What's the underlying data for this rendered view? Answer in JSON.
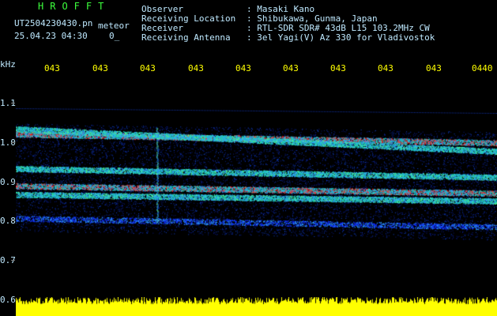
{
  "header": {
    "brand": "HROFFT",
    "filename": "UT2504230430.pn",
    "filename_tag": "meteor",
    "datetime": "25.04.23 04:30",
    "count": "0_"
  },
  "info": [
    {
      "label": "Observer",
      "value": ": Masaki Kano"
    },
    {
      "label": "Receiving Location",
      "value": ": Shibukawa, Gunma, Japan"
    },
    {
      "label": "Receiver",
      "value": ": RTL-SDR SDR# 43dB L15 103.2MHz CW"
    },
    {
      "label": "Receiving Antenna",
      "value": ": 3el Yagi(V) Az 330 for Vladivostok"
    }
  ],
  "colors": {
    "background": "#000000",
    "header_text": "#bfe9ff",
    "brand": "#3cff3c",
    "axis_time": "#ffff00",
    "noise_strip": "#ffff00",
    "signal_low": "#1030ff",
    "signal_mid": "#20d0c0",
    "signal_high": "#ff3030"
  },
  "axis": {
    "unit": "kHz",
    "y_ticks": [
      "1.1",
      "1.0",
      "0.9",
      "0.8",
      "0.7",
      "0.6"
    ],
    "x_ticks": [
      "043",
      "043",
      "043",
      "043",
      "043",
      "043",
      "043",
      "043",
      "043",
      "0440"
    ]
  },
  "spectrogram": {
    "y_range_khz": [
      0.6,
      1.12
    ],
    "bands_khz": [
      {
        "start": 0.985,
        "end": 0.965,
        "level": "high"
      },
      {
        "start": 0.997,
        "end": 0.945,
        "level": "mid"
      },
      {
        "start": 0.905,
        "end": 0.885,
        "level": "mid"
      },
      {
        "start": 0.865,
        "end": 0.848,
        "level": "high"
      },
      {
        "start": 0.845,
        "end": 0.83,
        "level": "mid"
      },
      {
        "start": 0.79,
        "end": 0.77,
        "level": "low"
      }
    ],
    "meteor_time_fraction": 0.3
  }
}
